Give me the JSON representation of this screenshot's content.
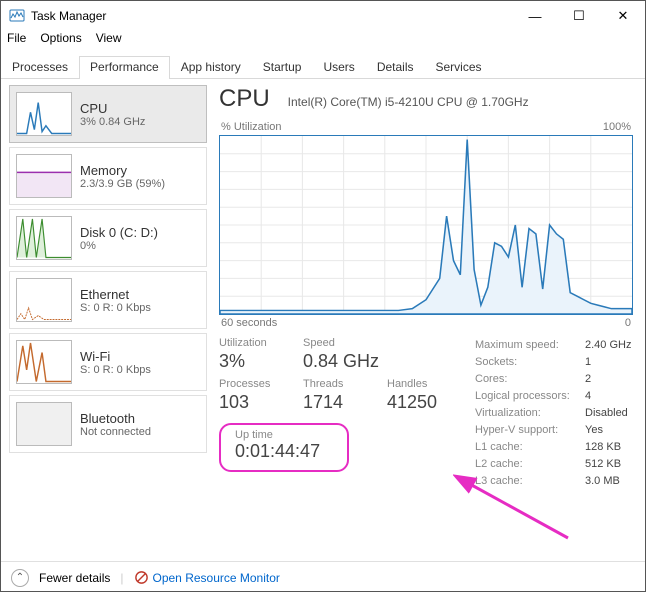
{
  "window": {
    "title": "Task Manager"
  },
  "menu": {
    "file": "File",
    "options": "Options",
    "view": "View"
  },
  "tabs": {
    "processes": "Processes",
    "performance": "Performance",
    "apphistory": "App history",
    "startup": "Startup",
    "users": "Users",
    "details": "Details",
    "services": "Services"
  },
  "sidebar": {
    "items": [
      {
        "name": "CPU",
        "sub": "3% 0.84 GHz"
      },
      {
        "name": "Memory",
        "sub": "2.3/3.9 GB (59%)"
      },
      {
        "name": "Disk 0 (C: D:)",
        "sub": "0%"
      },
      {
        "name": "Ethernet",
        "sub": "S: 0 R: 0 Kbps"
      },
      {
        "name": "Wi-Fi",
        "sub": "S: 0 R: 0 Kbps"
      },
      {
        "name": "Bluetooth",
        "sub": "Not connected"
      }
    ]
  },
  "content": {
    "title": "CPU",
    "model": "Intel(R) Core(TM) i5-4210U CPU @ 1.70GHz",
    "chart_top_left": "% Utilization",
    "chart_top_right": "100%",
    "chart_bottom_left": "60 seconds",
    "chart_bottom_right": "0",
    "stats_left": {
      "utilization_label": "Utilization",
      "utilization": "3%",
      "speed_label": "Speed",
      "speed": "0.84 GHz",
      "processes_label": "Processes",
      "processes": "103",
      "threads_label": "Threads",
      "threads": "1714",
      "handles_label": "Handles",
      "handles": "41250"
    },
    "uptime": {
      "label": "Up time",
      "value": "0:01:44:47"
    },
    "stats_right": {
      "max_speed_k": "Maximum speed:",
      "max_speed_v": "2.40 GHz",
      "sockets_k": "Sockets:",
      "sockets_v": "1",
      "cores_k": "Cores:",
      "cores_v": "2",
      "lproc_k": "Logical processors:",
      "lproc_v": "4",
      "virt_k": "Virtualization:",
      "virt_v": "Disabled",
      "hyperv_k": "Hyper-V support:",
      "hyperv_v": "Yes",
      "l1_k": "L1 cache:",
      "l1_v": "128 KB",
      "l2_k": "L2 cache:",
      "l2_v": "512 KB",
      "l3_k": "L3 cache:",
      "l3_v": "3.0 MB"
    }
  },
  "bottom": {
    "fewer": "Fewer details",
    "resmon": "Open Resource Monitor"
  },
  "chart_data": {
    "type": "line",
    "title": "% Utilization",
    "xlabel": "seconds ago",
    "ylabel": "% Utilization",
    "ylim": [
      0,
      100
    ],
    "xlim": [
      60,
      0
    ],
    "x": [
      60,
      58,
      56,
      54,
      52,
      50,
      48,
      46,
      44,
      42,
      40,
      38,
      36,
      34,
      32,
      30,
      28,
      27,
      26,
      25,
      24,
      23,
      22,
      21,
      20,
      19,
      18,
      17,
      16,
      15,
      14,
      13,
      12,
      11,
      10,
      9,
      8,
      7,
      6,
      5,
      4,
      3,
      2,
      1,
      0
    ],
    "values": [
      2,
      2,
      2,
      2,
      2,
      2,
      2,
      2,
      2,
      2,
      2,
      2,
      2,
      2,
      3,
      8,
      20,
      55,
      30,
      22,
      98,
      25,
      5,
      15,
      40,
      38,
      32,
      50,
      15,
      48,
      45,
      14,
      50,
      45,
      42,
      12,
      10,
      8,
      6,
      5,
      4,
      3,
      3,
      3,
      3
    ]
  }
}
